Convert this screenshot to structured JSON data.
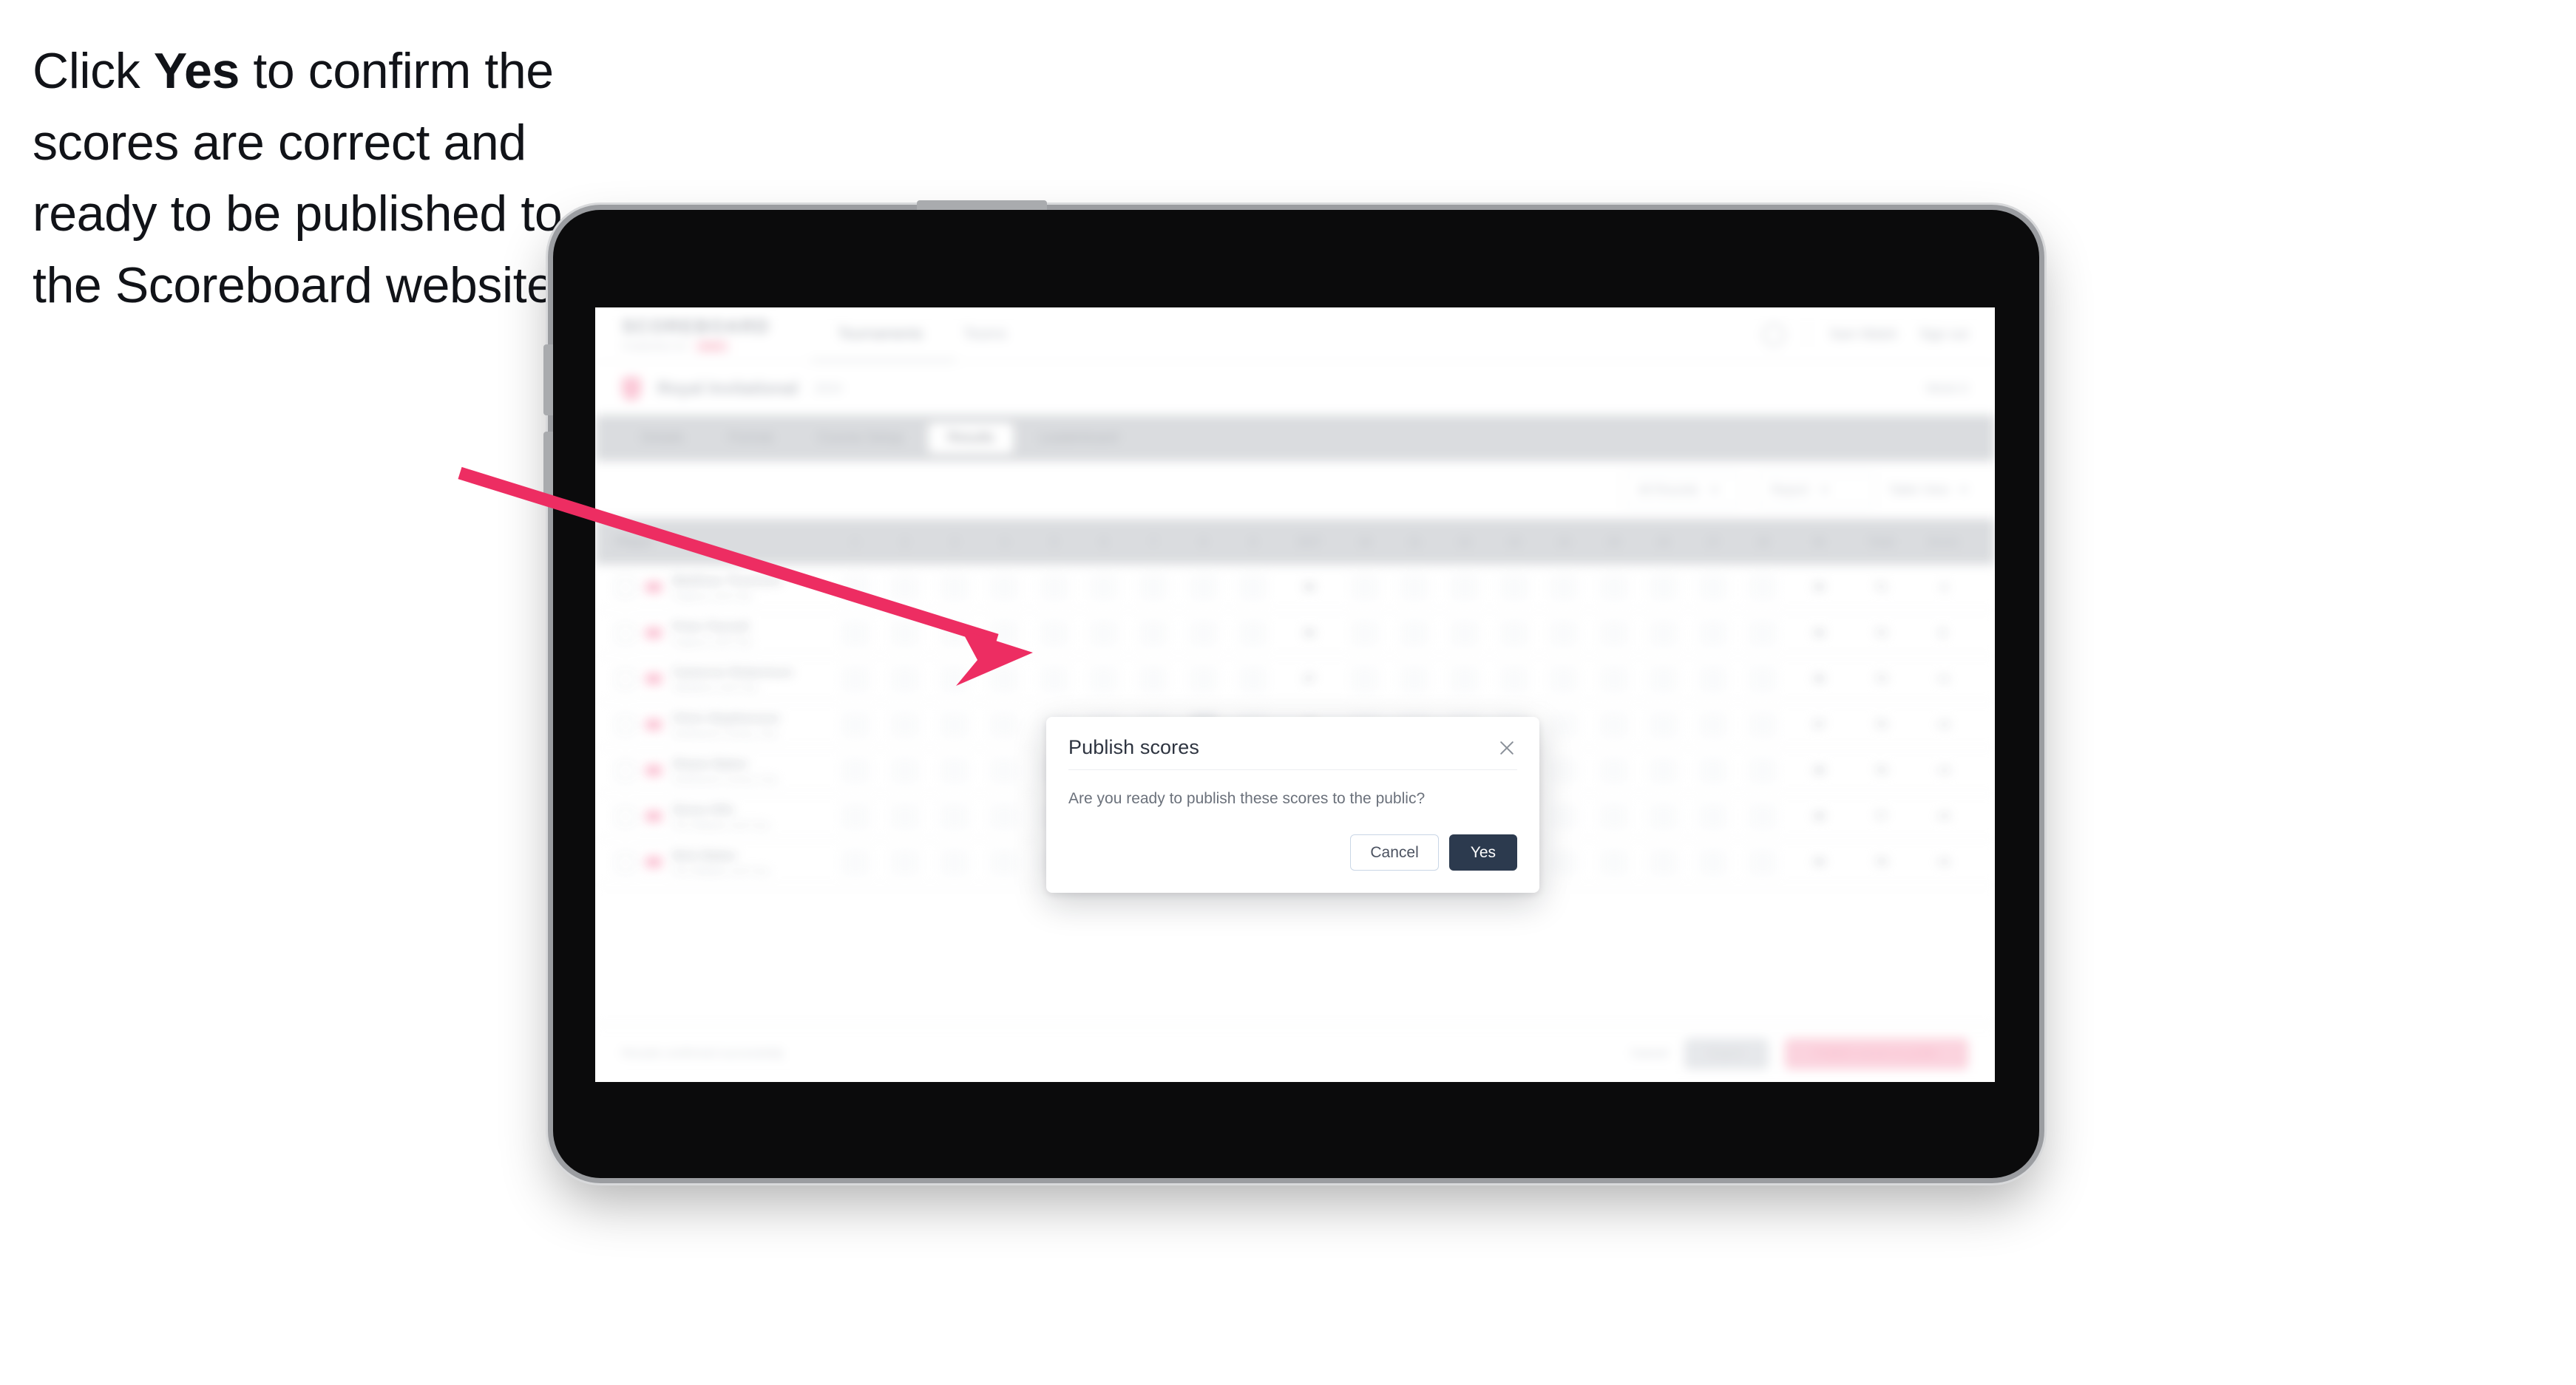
{
  "caption": {
    "before": "Click ",
    "keyword": "Yes",
    "after": " to confirm the scores are correct and ready to be published to the Scoreboard website."
  },
  "modal": {
    "title": "Publish scores",
    "message": "Are you ready to publish these scores to the public?",
    "cancel_label": "Cancel",
    "confirm_label": "Yes",
    "close_icon": "close-icon"
  },
  "colors": {
    "arrow": "#ed2d62",
    "confirm_button": "#2c3a4e",
    "cancel_border": "#c9d6e6",
    "brand_pink": "#f4869f",
    "device_bezel": "#9b9da1"
  },
  "app": {
    "header": {
      "logo": "SCOREBOARD",
      "logo_sub": "POWERED BY",
      "logo_pill": "GOLF",
      "nav": [
        {
          "label": "Tournaments"
        },
        {
          "label": "Teams"
        }
      ],
      "right": {
        "bell_icon": "bell-icon",
        "account_link": "Sam Walsh",
        "signout_link": "Sign out"
      }
    },
    "event": {
      "icon": "trophy-icon",
      "name": "Royal Invitational",
      "meta": "2024",
      "right": "Week 6"
    },
    "tabs": [
      {
        "label": "Details"
      },
      {
        "label": "Format"
      },
      {
        "label": "Course Setup"
      },
      {
        "label": "Results"
      },
      {
        "label": "Leaderboard"
      }
    ],
    "active_tab": "Results",
    "filters": {
      "round_label": "All Rounds",
      "report_label": "Report",
      "table_label": "Table View",
      "caret_icon": "chevron-down-icon"
    },
    "table": {
      "player_header": "Player",
      "hole_headers": [
        "1",
        "2",
        "3",
        "4",
        "5",
        "6",
        "7",
        "8",
        "9",
        "10",
        "11",
        "12",
        "13",
        "14",
        "15",
        "16",
        "17",
        "18"
      ],
      "summary_headers": [
        "OUT",
        "IN",
        "Total",
        "Score"
      ],
      "rows": [
        {
          "name": "Matthew Thomsen",
          "club": "Pegasus Golf Club",
          "out": "36",
          "in": "35",
          "total": "71",
          "score": "-1"
        },
        {
          "name": "Peter Parnell",
          "club": "Pegasus Golf Club",
          "out": "36",
          "in": "36",
          "total": "72",
          "score": "E"
        },
        {
          "name": "Cameron Robertson",
          "club": "Waitakere Golf Club",
          "out": "37",
          "in": "36",
          "total": "73",
          "score": "+1"
        },
        {
          "name": "Chris Stephenson",
          "club": "Northwood Country Club",
          "out": "38",
          "in": "37",
          "total": "75",
          "score": "+3"
        },
        {
          "name": "Shane Baker",
          "club": "Northwood Country Club",
          "out": "38",
          "in": "38",
          "total": "76",
          "score": "+4"
        },
        {
          "name": "Sione Hifo",
          "club": "Port Waikato Golf Club",
          "out": "39",
          "in": "38",
          "total": "77",
          "score": "+5"
        },
        {
          "name": "Nick Baker",
          "club": "Port Waikato Golf Club",
          "out": "39",
          "in": "39",
          "total": "78",
          "score": "+6"
        }
      ]
    },
    "footer": {
      "note": "Results confirmed successfully",
      "link": "Cancel",
      "secondary_button": "Export",
      "primary_button": "Publish scores to public"
    }
  }
}
